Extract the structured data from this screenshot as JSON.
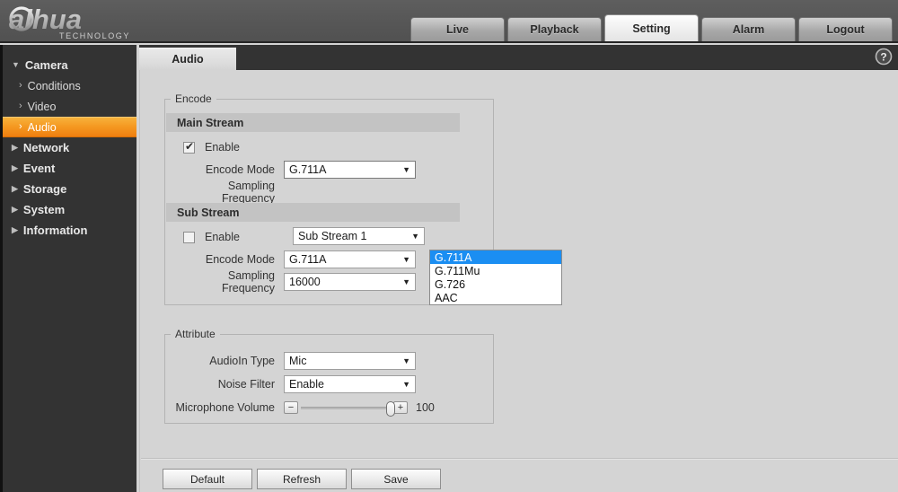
{
  "header": {
    "logo_text": "alhua",
    "logo_sub": "TECHNOLOGY",
    "nav": [
      {
        "label": "Live",
        "active": false
      },
      {
        "label": "Playback",
        "active": false
      },
      {
        "label": "Setting",
        "active": true
      },
      {
        "label": "Alarm",
        "active": false
      },
      {
        "label": "Logout",
        "active": false
      }
    ]
  },
  "sidebar": {
    "items": [
      {
        "label": "Camera",
        "type": "group",
        "expanded": true
      },
      {
        "label": "Conditions",
        "type": "sub"
      },
      {
        "label": "Video",
        "type": "sub"
      },
      {
        "label": "Audio",
        "type": "sub",
        "active": true
      },
      {
        "label": "Network",
        "type": "group",
        "expanded": false
      },
      {
        "label": "Event",
        "type": "group",
        "expanded": false
      },
      {
        "label": "Storage",
        "type": "group",
        "expanded": false
      },
      {
        "label": "System",
        "type": "group",
        "expanded": false
      },
      {
        "label": "Information",
        "type": "group",
        "expanded": false
      }
    ]
  },
  "panel": {
    "tab_label": "Audio",
    "help_icon": "question-mark-circle-icon"
  },
  "encode": {
    "legend": "Encode",
    "main_stream": {
      "header": "Main Stream",
      "enable_label": "Enable",
      "enable_checked": true,
      "encode_mode_label": "Encode Mode",
      "encode_mode_value": "G.711A",
      "sampling_frequency_label": "Sampling Frequency",
      "dropdown_open": true,
      "options": [
        "G.711A",
        "G.711Mu",
        "G.726",
        "AAC"
      ],
      "selected_option": "G.711A"
    },
    "sub_stream": {
      "header": "Sub Stream",
      "enable_label": "Enable",
      "enable_checked": false,
      "stream_select_value": "Sub Stream 1",
      "encode_mode_label": "Encode Mode",
      "encode_mode_value": "G.711A",
      "sampling_frequency_label": "Sampling Frequency",
      "sampling_frequency_value": "16000"
    }
  },
  "attribute": {
    "legend": "Attribute",
    "audioin_type_label": "AudioIn Type",
    "audioin_type_value": "Mic",
    "noise_filter_label": "Noise Filter",
    "noise_filter_value": "Enable",
    "microphone_volume_label": "Microphone Volume",
    "microphone_volume_value": "100",
    "minus_label": "−",
    "plus_label": "+"
  },
  "footer": {
    "buttons": [
      "Default",
      "Refresh",
      "Save"
    ]
  },
  "colors": {
    "accent_orange": "#f59a22",
    "dropdown_highlight": "#1b8ef2",
    "sidebar_bg": "#333333",
    "panel_bg": "#d4d4d4",
    "header_bg": "#575757"
  }
}
